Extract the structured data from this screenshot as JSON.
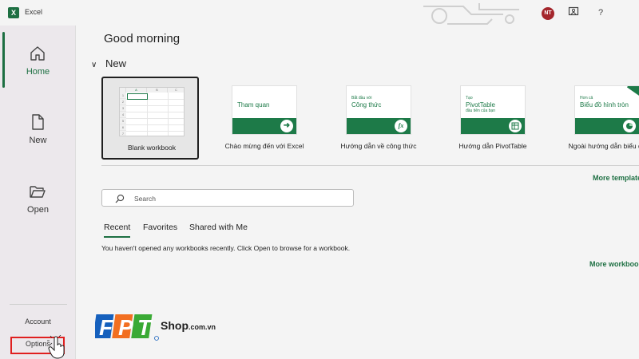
{
  "titlebar": {
    "app_name": "Excel",
    "user_initials": "NT",
    "help_icon": "?",
    "colors": {
      "excel_green": "#1d6f42",
      "avatar_red": "#a4262c"
    }
  },
  "sidebar": {
    "items": [
      {
        "label": "Home",
        "icon": "home-icon",
        "active": true
      },
      {
        "label": "New",
        "icon": "new-document-icon",
        "active": false
      },
      {
        "label": "Open",
        "icon": "folder-icon",
        "active": false
      }
    ],
    "account_label": "Account",
    "options_label": "Options"
  },
  "main": {
    "greeting": "Good morning",
    "new_section_label": "New",
    "templates": [
      {
        "caption": "Blank workbook",
        "kind": "blank",
        "sheet": {
          "columns": [
            "A",
            "B",
            "C"
          ],
          "rows": [
            "1",
            "2",
            "3",
            "4",
            "5",
            "6",
            "7"
          ]
        }
      },
      {
        "caption": "Chào mừng đến với Excel",
        "kind": "tour",
        "thumb_title": "Tham quan"
      },
      {
        "caption": "Hướng dẫn về công thức",
        "kind": "formula",
        "thumb_small": "Bắt đầu với",
        "thumb_title": "Công thức"
      },
      {
        "caption": "Hướng dẫn PivotTable",
        "kind": "pivot",
        "thumb_small": "Tạo",
        "thumb_title": "PivotTable",
        "thumb_sub": "đầu tiên của bạn"
      },
      {
        "caption": "Ngoài hướng dẫn biểu đồ",
        "kind": "chart",
        "thumb_small": "Hơn cả",
        "thumb_title": "Biểu đồ hình tròn"
      }
    ],
    "more_templates": "More templates",
    "search": {
      "placeholder": "Search"
    },
    "tabs": [
      {
        "label": "Recent",
        "active": true
      },
      {
        "label": "Favorites",
        "active": false
      },
      {
        "label": "Shared with Me",
        "active": false
      }
    ],
    "empty_message": "You haven't opened any workbooks recently. Click Open to browse for a workbook.",
    "more_workbooks": "More workbooks"
  },
  "watermark": {
    "brand": "FPT",
    "shop_label": "Shop",
    "domain_suffix": ".com.vn",
    "colors": {
      "blue": "#1560bd",
      "orange": "#f26f21",
      "green": "#3aaa35"
    }
  }
}
